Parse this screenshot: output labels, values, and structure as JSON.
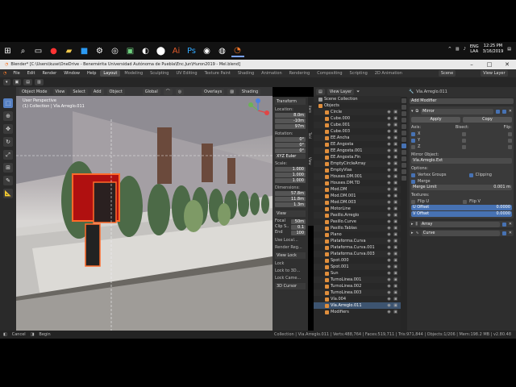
{
  "taskbar": {
    "clock_time": "12:25 PM",
    "clock_date": "3/16/2019",
    "lang": "ENG",
    "lang_sub": "LAA"
  },
  "window": {
    "title": "Blender* [C:\\Users\\kuse\\OneDrive - Benemérita Universidad Autónoma de Puebla\\Enc.Jun\\Huron2019 - Mel.blend]"
  },
  "menu": {
    "items": [
      "File",
      "Edit",
      "Render",
      "Window",
      "Help"
    ],
    "workspaces": [
      "Layout",
      "Modeling",
      "Sculpting",
      "UV Editing",
      "Texture Paint",
      "Shading",
      "Animation",
      "Rendering",
      "Compositing",
      "Scripting",
      "2D Animation"
    ],
    "active_workspace": "Layout",
    "scene": "Scene",
    "view_layer": "View Layer"
  },
  "viewport": {
    "mode": "Object Mode",
    "view": "View",
    "select": "Select",
    "add": "Add",
    "object": "Object",
    "orientation": "Global",
    "overlays": "Overlays",
    "shading": "Shading",
    "info1": "User Perspective",
    "info2": "(1) Collection | Vía.Arreglo.011"
  },
  "npanel": {
    "transform": "Transform",
    "location": "Location:",
    "loc": [
      "8.0m",
      "-10m",
      "97m"
    ],
    "rotation": "Rotation:",
    "rot": [
      "0°",
      "0°",
      "0°"
    ],
    "mode": "XYZ Euler",
    "scale": "Scale:",
    "scl": [
      "1.000",
      "1.000",
      "1.000"
    ],
    "dimensions": "Dimensions:",
    "dim": [
      "57.8m",
      "11.8m",
      "1.3m"
    ],
    "view": "View",
    "focal": "Focal",
    "focal_val": "50m",
    "clip_s": "Clip S..",
    "clip_s_val": "0.1",
    "clip_e": "End",
    "clip_e_val": "100",
    "local": "Use Local...",
    "render_reg": "Render Reg...",
    "view_lock": "View Lock",
    "lock": "Lock",
    "lock3d": "Lock to 3D...",
    "lock_cam": "Lock Came...",
    "cursor": "3D Cursor"
  },
  "vtabs": [
    "Item",
    "Tool",
    "View"
  ],
  "outliner": {
    "rows": [
      "Scene Collection",
      "Objects",
      "Circle",
      "Cube.000",
      "Cube.001",
      "Cube.003",
      "EE.Ancha",
      "EE.Angosta",
      "EE.Angosta.001",
      "EE.Angosta.Fin",
      "EmptyCircleArray",
      "EmptyVias",
      "Houses.DM.001",
      "Houses.DM.TD",
      "Mod.DM",
      "Mod.DM.001",
      "Mod.DM.003",
      "MotorLine",
      "Pasillo.Arreglo",
      "Pasillo.Curve",
      "Pasillo.Tablas",
      "Plano",
      "Plataforma.Curva",
      "Plataforma.Curva.001",
      "Plataforma.Curva.003",
      "Spot.000",
      "Spot.001",
      "Sun",
      "TurnoLinea.001",
      "TurnoLinea.002",
      "TurnoLinea.003",
      "Vía.004",
      "Vía.Arreglo.011",
      "Modifiers"
    ],
    "selected": "Vía.Arreglo.011",
    "header_layer": "View Layer"
  },
  "props": {
    "object": "Vía.Arreglo.011",
    "add_modifier": "Add Modifier",
    "mod_name": "Mirror",
    "apply": "Apply",
    "copy": "Copy",
    "axis": "Axis:",
    "bisect": "Bisect:",
    "flip": "Flip:",
    "x": "X",
    "y": "Y",
    "z": "Z",
    "mirror_obj": "Mirror Object:",
    "mirror_obj_val": "Vía.Arreglo.Ext",
    "options": "Options:",
    "vgroups": "Vertex Groups",
    "clipping": "Clipping",
    "merge": "Merge",
    "merge_limit": "Merge Limit",
    "merge_val": "0.001 m",
    "textures": "Textures:",
    "flip_u": "Flip U",
    "flip_v": "Flip V",
    "u_offset": "U Offset",
    "u_val": "0.0000",
    "v_offset": "V Offset",
    "v_val": "0.0000",
    "mod2": "Array",
    "mod3": "Curve"
  },
  "status": {
    "left1": "Cancel",
    "left2": "Begin",
    "right": "Collection | Vía.Arreglo.011 | Verts:488,764 | Faces:519,711 | Tris:971,844 | Objects:1/206 | Mem:198.2 MB | v2.80.48"
  }
}
